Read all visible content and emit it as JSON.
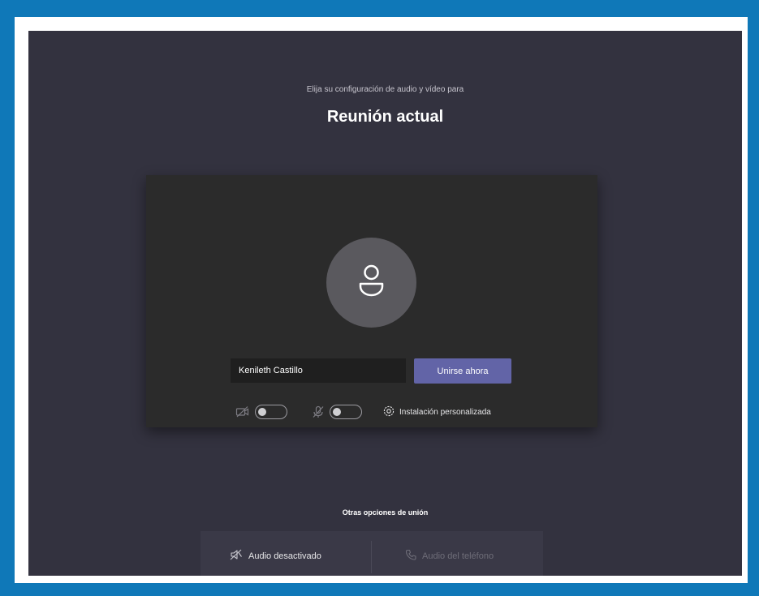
{
  "header": {
    "subtitle": "Elija su configuración de audio y vídeo para",
    "title": "Reunión actual"
  },
  "prejoin": {
    "avatar_icon": "person-icon",
    "name_value": "Kenileth Castillo",
    "join_label": "Unirse ahora",
    "camera_toggle": {
      "icon": "video-off-icon",
      "state": "off"
    },
    "mic_toggle": {
      "icon": "mic-off-icon",
      "state": "off"
    },
    "custom_setup_label": "Instalación personalizada",
    "custom_setup_icon": "gear-icon"
  },
  "other_options": {
    "label": "Otras opciones de unión",
    "items": [
      {
        "label": "Audio desactivado",
        "icon": "speaker-off-icon"
      },
      {
        "label": "Audio del teléfono",
        "icon": "phone-icon"
      }
    ]
  },
  "colors": {
    "frame": "#0f78b8",
    "background": "#33323f",
    "card": "#2b2b2b",
    "accent": "#6264a7"
  }
}
